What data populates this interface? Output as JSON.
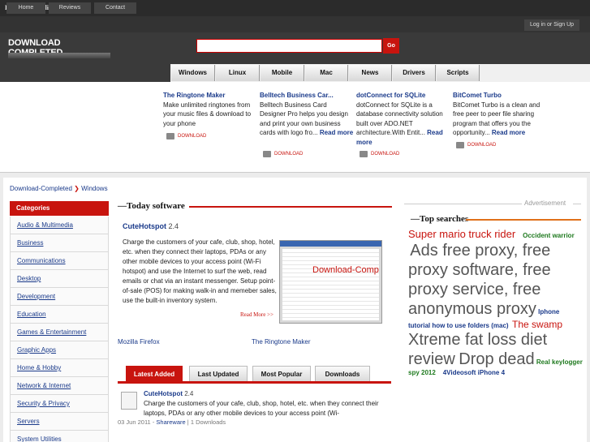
{
  "topbar": {
    "title": "Download quality software"
  },
  "nav": {
    "items": [
      "Home",
      "Reviews",
      "Contact"
    ],
    "login": "Log in or Sign Up"
  },
  "logo": {
    "text": "DOWNLOAD COMPLETED"
  },
  "search": {
    "value": "",
    "go_label": "Go"
  },
  "categories_bar": [
    "Windows",
    "Linux",
    "Mobile",
    "Mac",
    "News",
    "Drivers",
    "Scripts"
  ],
  "featured": [
    {
      "title": "The Ringtone Maker",
      "desc": "Make unlimited ringtones from your music files & download to your phone",
      "more": "",
      "dl": "DOWNLOAD"
    },
    {
      "title": "Belltech Business Car...",
      "desc": "Belltech Business Card Designer Pro helps you design and print your own business cards with logo fro...",
      "more": "Read more",
      "dl": "DOWNLOAD"
    },
    {
      "title": "dotConnect for SQLite",
      "desc": "dotConnect for SQLite is a database connectivity solution built over ADO.NET architecture.With Entit...",
      "more": "Read more",
      "dl": "DOWNLOAD"
    },
    {
      "title": "BitComet Turbo",
      "desc": "BitComet Turbo is a clean and free peer to peer file sharing program that offers you the opportunity...",
      "more": "Read more",
      "dl": "DOWNLOAD"
    }
  ],
  "breadcrumb": {
    "home": "Download-Completed",
    "sep": "❯",
    "current": "Windows"
  },
  "sidebar": {
    "heading": "Categories",
    "items": [
      "Audio & Multimedia",
      "Business",
      "Communications",
      "Desktop",
      "Development",
      "Education",
      "Games & Entertainment",
      "Graphic Apps",
      "Home & Hobby",
      "Network & Internet",
      "Security & Privacy",
      "Servers",
      "System Utilities"
    ]
  },
  "today": {
    "heading": "Today software",
    "title": "CuteHotspot",
    "version": "2.4",
    "desc": "Charge the customers of your cafe, club, shop, hotel, etc. when they connect their laptops, PDAs or any other mobile devices to your access point (Wi-Fi hotspot) and use the Internet to surf the web, read emails or chat via an instant messenger. Setup point-of-sale (POS) for making walk-in and memeber sales, use the built-in inventory system.",
    "watermark": "Download-Comp",
    "read_more": "Read More >>",
    "related": [
      "Mozilla Firefox",
      "The Ringtone Maker"
    ]
  },
  "tabs": [
    "Latest Added",
    "Last Updated",
    "Most Popular",
    "Downloads"
  ],
  "latest": {
    "title": "CuteHotspot",
    "version": "2.4",
    "desc": "Charge the customers of your cafe, club, shop, hotel, etc. when they connect their laptops, PDAs or any other mobile devices to your access point (Wi-",
    "date": "03 Jun 2011",
    "license": "Shareware",
    "downloads": "1 Downloads"
  },
  "advertisement": "Advertisement",
  "top_searches": {
    "heading": "Top searches",
    "tags": [
      {
        "text": "Super mario truck rider",
        "style": "lr"
      },
      {
        "text": "Occident warrior",
        "style": "sg"
      },
      {
        "text": "Ads free proxy, free proxy software, free proxy service, free anonymous proxy",
        "style": "ls"
      },
      {
        "text": "Iphone tutorial how to use folders (mac)",
        "style": "sb"
      },
      {
        "text": "The swamp",
        "style": "mr"
      },
      {
        "text": "Xtreme fat loss diet review",
        "style": "ls"
      },
      {
        "text": "Drop dead",
        "style": "ls"
      },
      {
        "text": "Real keylogger spy 2012",
        "style": "sg"
      },
      {
        "text": "4Videosoft iPhone 4",
        "style": "sb"
      }
    ]
  },
  "colors": {
    "accent": "#c8140e",
    "link": "#1a3a8a",
    "dark": "#333333"
  }
}
